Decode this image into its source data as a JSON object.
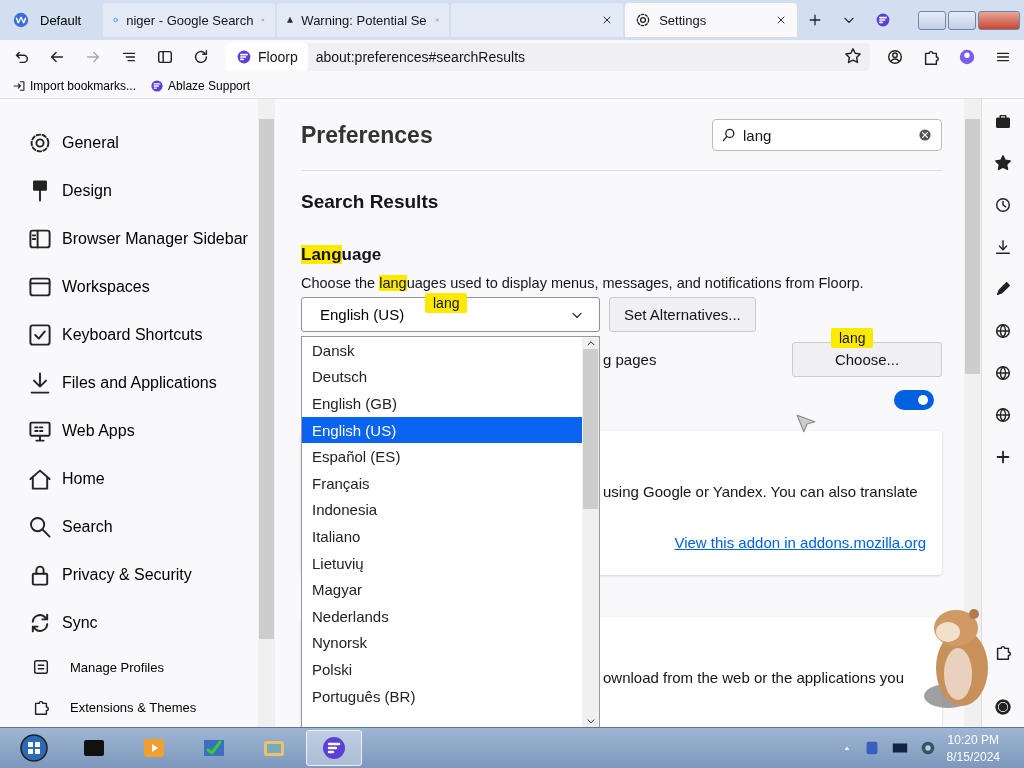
{
  "workspace": {
    "label": "Default"
  },
  "tabs": [
    {
      "title": "niger - Google Search",
      "kind": "google",
      "selected": false
    },
    {
      "title": "Warning: Potential Se",
      "kind": "warning",
      "selected": false
    },
    {
      "kind": "hidden",
      "selected": false
    },
    {
      "title": "Settings",
      "kind": "settings",
      "selected": true
    }
  ],
  "url_bar": {
    "identity": "Floorp",
    "url": "about:preferences#searchResults"
  },
  "bookmarks": [
    {
      "label": "Import bookmarks...",
      "kind": "import"
    },
    {
      "label": "Ablaze Support",
      "kind": "floorp"
    }
  ],
  "sidebar": {
    "items": [
      {
        "label": "General",
        "kind": "main"
      },
      {
        "label": "Design",
        "kind": "main"
      },
      {
        "label": "Browser Manager Sidebar",
        "kind": "main"
      },
      {
        "label": "Workspaces",
        "kind": "main"
      },
      {
        "label": "Keyboard Shortcuts",
        "kind": "main"
      },
      {
        "label": "Files and Applications",
        "kind": "main"
      },
      {
        "label": "Web Apps",
        "kind": "main"
      },
      {
        "label": "Home",
        "kind": "main"
      },
      {
        "label": "Search",
        "kind": "main"
      },
      {
        "label": "Privacy & Security",
        "kind": "main"
      },
      {
        "label": "Sync",
        "kind": "main"
      },
      {
        "label": "Manage Profiles",
        "kind": "footer"
      },
      {
        "label": "Extensions & Themes",
        "kind": "footer"
      }
    ]
  },
  "page": {
    "title": "Preferences",
    "search": {
      "value": "lang"
    },
    "section": "Search Results",
    "language": {
      "heading": [
        {
          "text": "Lang",
          "highlight": true
        },
        {
          "text": "uage",
          "highlight": false
        }
      ],
      "description": [
        {
          "text": "Choose the ",
          "highlight": false
        },
        {
          "text": "lang",
          "highlight": true
        },
        {
          "text": "uages used to display menus, messages, and notifications from Floorp.",
          "highlight": false
        }
      ],
      "select": {
        "value": "English (US)",
        "expanded": true
      },
      "set_alternatives": "Set Alternatives...",
      "options": [
        {
          "label": "Dansk",
          "selected": false
        },
        {
          "label": "Deutsch",
          "selected": false
        },
        {
          "label": "English (GB)",
          "selected": false
        },
        {
          "label": "English (US)",
          "selected": true
        },
        {
          "label": "Español (ES)",
          "selected": false
        },
        {
          "label": "Français",
          "selected": false
        },
        {
          "label": "Indonesia",
          "selected": false
        },
        {
          "label": "Italiano",
          "selected": false
        },
        {
          "label": "Lietuvių",
          "selected": false
        },
        {
          "label": "Magyar",
          "selected": false
        },
        {
          "label": "Nederlands",
          "selected": false
        },
        {
          "label": "Nynorsk",
          "selected": false
        },
        {
          "label": "Polski",
          "selected": false
        },
        {
          "label": "Português (BR)",
          "selected": false
        }
      ],
      "tooltips": [
        "lang",
        "lang"
      ]
    },
    "fonts_row": {
      "text": "g pages",
      "button": "Choose..."
    },
    "toggle": {
      "on": true
    },
    "cards": [
      {
        "text": "using Google or Yandex. You can also translate",
        "link": "View this addon in addons.mozilla.org"
      },
      {
        "text": "ownload from the web or the applications you"
      }
    ]
  },
  "taskbar": {
    "apps": [
      {
        "selected": false
      },
      {
        "selected": false
      },
      {
        "selected": false
      },
      {
        "selected": false
      },
      {
        "selected": false
      },
      {
        "selected": true
      }
    ],
    "time": "10:20 PM",
    "date": "8/15/2024"
  }
}
